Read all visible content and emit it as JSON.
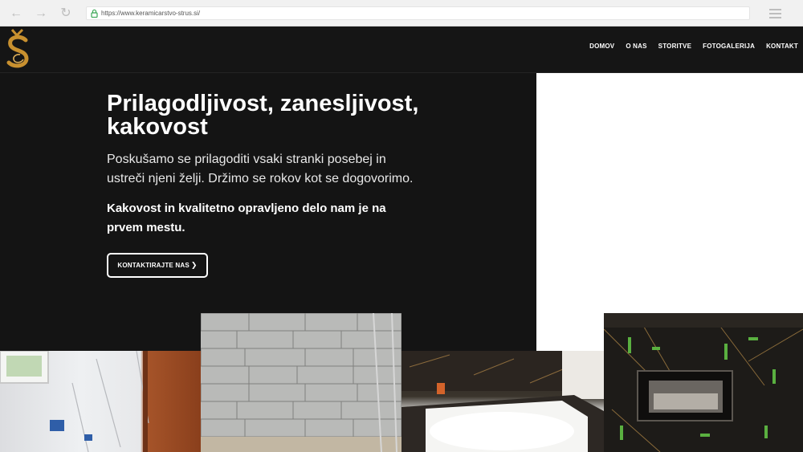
{
  "browser": {
    "url": "https://www.keramicarstvo-strus.si/"
  },
  "nav": {
    "items": [
      "DOMOV",
      "O NAS",
      "STORITVE",
      "FOTOGALERIJA",
      "KONTAKT"
    ]
  },
  "hero": {
    "title": "Prilagodljivost, zanesljivost, kakovost",
    "text": "Poskušamo se prilagoditi vsaki stranki posebej in ustreči njeni želji. Držimo se rokov kot se dogovorimo.",
    "strong_text": "Kakovost in kvalitetno opravljeno delo nam je na prvem mestu.",
    "cta_label": "KONTAKTIRAJTE NAS"
  },
  "colors": {
    "background": "#141414",
    "accent_gold": "#c8902f",
    "text": "#ffffff"
  },
  "icons": [
    "back-arrow-icon",
    "forward-arrow-icon",
    "reload-icon",
    "lock-icon",
    "hamburger-menu-icon",
    "chevron-right-icon",
    "logo"
  ]
}
